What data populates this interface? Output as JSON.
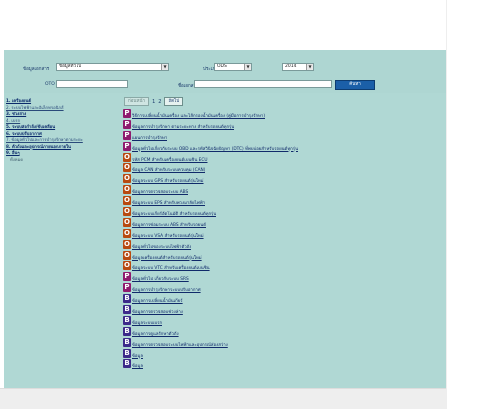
{
  "filters": {
    "category_label": "ข้อมูลเอกสาร",
    "category_value": "ข้อมูลทั่วไป",
    "type_label": "ประเภท",
    "type_value": "ODS",
    "year_value": "2014",
    "oto_label": "OTO",
    "name_label": "ชื่อเอกสาร",
    "search_button": "ค้นหา"
  },
  "nav": {
    "items": [
      "1. เครื่องยนต์",
      "2. ระบบไฟฟ้าและอิเล็กทรอนิกส์",
      "3. ช่วงล่าง",
      "4. เบรก",
      "5. ระบบส่งกำลัง/ขับเคลื่อน",
      "6. ระบบปรับอากาศ",
      "7. ข้อมูลทั่วไปและการบำรุงรักษาตามระยะ",
      "8. ตัวถังและอุปกรณ์ภายนอกภายใน",
      "9. อื่นๆ",
      "ทั้งหมด"
    ]
  },
  "pager": {
    "prev": "ก่อนหน้า",
    "page1": "1",
    "page2": "2",
    "next": "ถัดไป"
  },
  "rows": [
    {
      "badge": "P",
      "text": "วิธีการเปลี่ยนน้ำมันเครื่อง และไส้กรองน้ำมันเครื่อง (คู่มือการบำรุงรักษา)"
    },
    {
      "badge": "P",
      "text": "ข้อมูลการบำรุงรักษา ตามระยะทาง สำหรับรถยนต์ทุกรุ่น"
    },
    {
      "badge": "P",
      "text": "แผนการบำรุงรักษา"
    },
    {
      "badge": "P",
      "text": "ข้อมูลทั่วไปเกี่ยวกับระบบ OBD และรหัสวินิจฉัยปัญหา (DTC) ที่พบบ่อยสำหรับรถยนต์ทุกรุ่น"
    },
    {
      "badge": "O",
      "text": "รหัส PCM สำหรับเครื่องยนต์เบนซิน ECU"
    },
    {
      "badge": "O",
      "text": "ข้อมูล CAN สำหรับระบบควบคุม (CAN)"
    },
    {
      "badge": "O",
      "text": "ข้อมูลระบบ GPS สำหรับรถยนต์รุ่นใหม่"
    },
    {
      "badge": "O",
      "text": "ข้อมูลการตรวจสอบระบบ ABS"
    },
    {
      "badge": "O",
      "text": "ข้อมูลระบบ EPS สำหรับพวงมาลัยไฟฟ้า"
    },
    {
      "badge": "O",
      "text": "ข้อมูลระบบเกียร์อัตโนมัติ สำหรับรถยนต์ทุกรุ่น"
    },
    {
      "badge": "O",
      "text": "ข้อมูลการซ่อมระบบ ABS สำหรับรถยนต์"
    },
    {
      "badge": "O",
      "text": "ข้อมูลระบบ VSA สำหรับรถยนต์รุ่นใหม่"
    },
    {
      "badge": "O",
      "text": "ข้อมูลทั่วไปของระบบไฟฟ้าตัวถัง"
    },
    {
      "badge": "O",
      "text": "ข้อมูลเครื่องยนต์สำหรับรถยนต์รุ่นใหม่"
    },
    {
      "badge": "O",
      "text": "ข้อมูลระบบ VTC สำหรับเครื่องยนต์เบนซิน"
    },
    {
      "badge": "P",
      "text": "ข้อมูลทั่วไป เกี่ยวกับระบบ SRS"
    },
    {
      "badge": "P",
      "text": "ข้อมูลการบำรุงรักษาระบบปรับอากาศ"
    },
    {
      "badge": "B",
      "text": "ข้อมูลการเปลี่ยนน้ำมันเกียร์"
    },
    {
      "badge": "B",
      "text": "ข้อมูลการตรวจสอบช่วงล่าง"
    },
    {
      "badge": "B",
      "text": "ข้อมูลระบบเบรก"
    },
    {
      "badge": "B",
      "text": "ข้อมูลการดูแลรักษาตัวถัง"
    },
    {
      "badge": "B",
      "text": "ข้อมูลการตรวจสอบระบบไฟฟ้าและอุปกรณ์ส่องสว่าง"
    },
    {
      "badge": "B",
      "text": "ข้อมูล"
    },
    {
      "badge": "B",
      "text": "ข้อมูล"
    }
  ]
}
